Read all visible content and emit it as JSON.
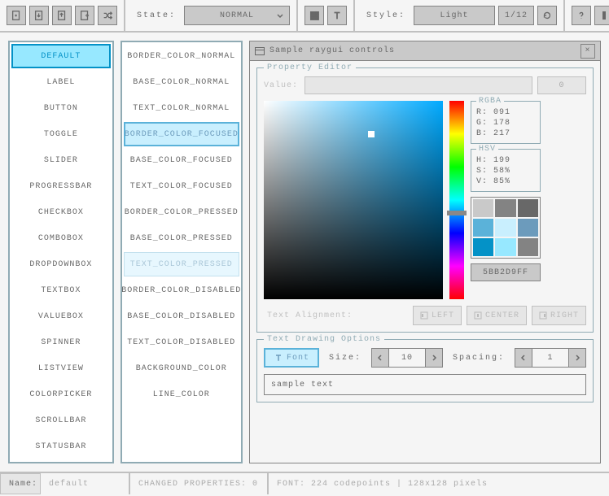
{
  "toolbar": {
    "state_label": "State:",
    "state_value": "NORMAL",
    "style_label": "Style:",
    "style_value": "Light",
    "style_page": "1/12"
  },
  "controls": [
    "DEFAULT",
    "LABEL",
    "BUTTON",
    "TOGGLE",
    "SLIDER",
    "PROGRESSBAR",
    "CHECKBOX",
    "COMBOBOX",
    "DROPDOWNBOX",
    "TEXTBOX",
    "VALUEBOX",
    "SPINNER",
    "LISTVIEW",
    "COLORPICKER",
    "SCROLLBAR",
    "STATUSBAR"
  ],
  "controls_selected": 0,
  "properties": [
    "BORDER_COLOR_NORMAL",
    "BASE_COLOR_NORMAL",
    "TEXT_COLOR_NORMAL",
    "BORDER_COLOR_FOCUSED",
    "BASE_COLOR_FOCUSED",
    "TEXT_COLOR_FOCUSED",
    "BORDER_COLOR_PRESSED",
    "BASE_COLOR_PRESSED",
    "TEXT_COLOR_PRESSED",
    "BORDER_COLOR_DISABLED",
    "BASE_COLOR_DISABLED",
    "TEXT_COLOR_DISABLED",
    "BACKGROUND_COLOR",
    "LINE_COLOR"
  ],
  "properties_focused": 3,
  "properties_hover": 8,
  "panel": {
    "title": "Sample raygui controls",
    "prop_editor": "Property Editor",
    "value_label": "Value:",
    "value_num": "0",
    "rgba_title": "RGBA",
    "rgba": {
      "r": "R:  091",
      "g": "G:  178",
      "b": "B:  217"
    },
    "hsv_title": "HSV",
    "hsv": {
      "h": "H:  199",
      "s": "S:  58%",
      "v": "V:  85%"
    },
    "hex": "5BB2D9FF",
    "align_label": "Text Alignment:",
    "align_left": "LEFT",
    "align_center": "CENTER",
    "align_right": "RIGHT",
    "text_opts_title": "Text Drawing Options",
    "font_btn": "Font",
    "size_label": "Size:",
    "size_val": "10",
    "spacing_label": "Spacing:",
    "spacing_val": "1",
    "sample_text": "sample text"
  },
  "swatches": [
    "#c9c9c9",
    "#838383",
    "#686868",
    "#5bb2d9",
    "#c9effe",
    "#6c9bbc",
    "#0492c7",
    "#97e8ff",
    "#838383"
  ],
  "statusbar": {
    "name_label": "Name:",
    "name_value": "default",
    "changed": "CHANGED PROPERTIES: 0",
    "font": "FONT: 224 codepoints | 128x128 pixels"
  }
}
